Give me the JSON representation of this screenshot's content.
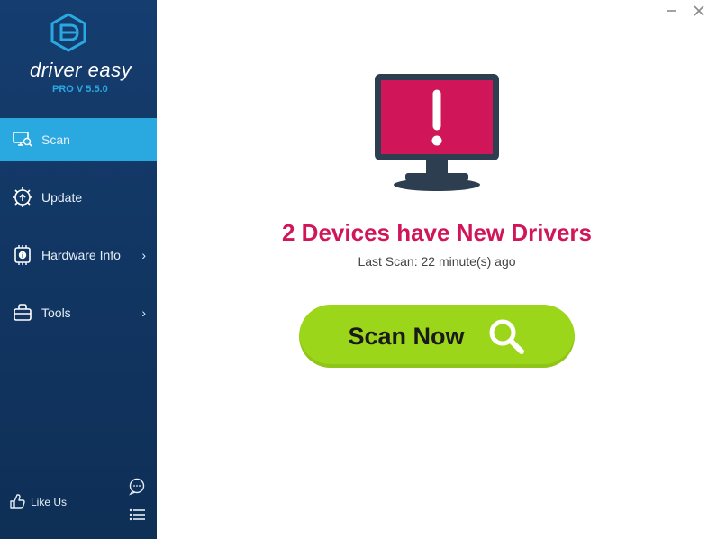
{
  "app": {
    "name": "driver easy",
    "version_label": "PRO V 5.5.0"
  },
  "nav": {
    "scan": "Scan",
    "update": "Update",
    "hardware": "Hardware Info",
    "tools": "Tools"
  },
  "bottom": {
    "like_label": "Like Us"
  },
  "main": {
    "headline": "2 Devices have New Drivers",
    "subline": "Last Scan: 22 minute(s) ago",
    "scan_button": "Scan Now"
  },
  "colors": {
    "accent": "#2aa8e0",
    "alert": "#d01659",
    "action": "#9cd61a"
  }
}
